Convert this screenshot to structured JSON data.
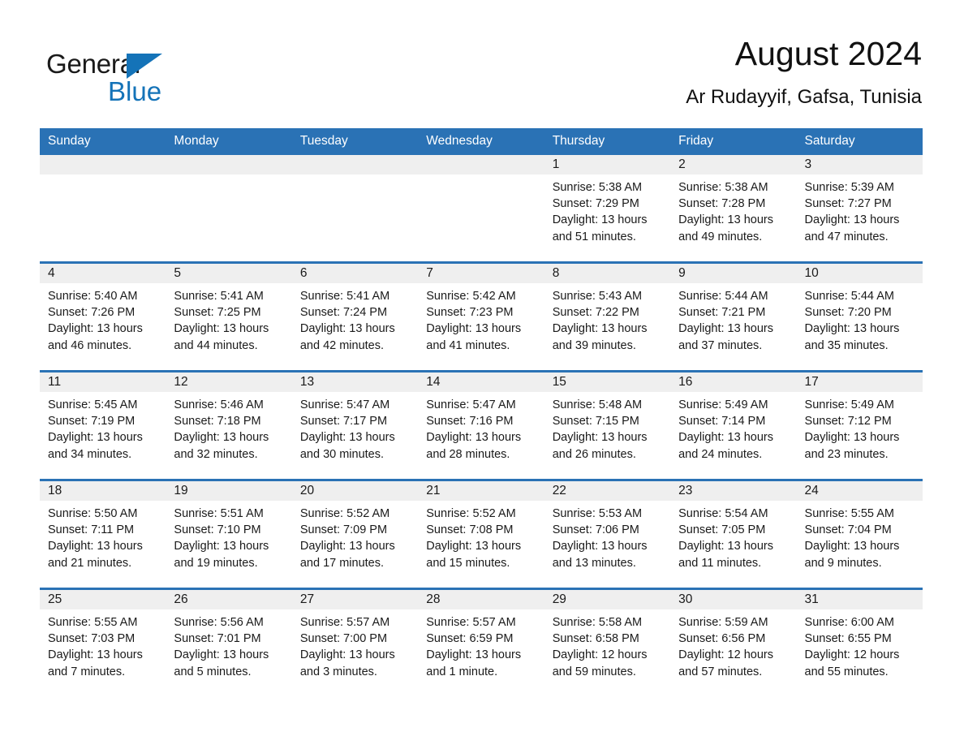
{
  "brand": {
    "name_part1": "General",
    "name_part2": "Blue",
    "triangle_color": "#1473b8"
  },
  "header": {
    "title": "August 2024",
    "subtitle": "Ar Rudayyif, Gafsa, Tunisia"
  },
  "colors": {
    "header_blue": "#2a72b5",
    "row_divider_blue": "#2a72b5",
    "daynum_band_gray": "#efefef",
    "text": "#1a1a1a",
    "background": "#ffffff"
  },
  "weekday_headers": [
    "Sunday",
    "Monday",
    "Tuesday",
    "Wednesday",
    "Thursday",
    "Friday",
    "Saturday"
  ],
  "weeks": [
    [
      {
        "empty": true
      },
      {
        "empty": true
      },
      {
        "empty": true
      },
      {
        "empty": true
      },
      {
        "empty": false,
        "day": "1",
        "sunrise": "Sunrise: 5:38 AM",
        "sunset": "Sunset: 7:29 PM",
        "daylight_l1": "Daylight: 13 hours",
        "daylight_l2": "and 51 minutes."
      },
      {
        "empty": false,
        "day": "2",
        "sunrise": "Sunrise: 5:38 AM",
        "sunset": "Sunset: 7:28 PM",
        "daylight_l1": "Daylight: 13 hours",
        "daylight_l2": "and 49 minutes."
      },
      {
        "empty": false,
        "day": "3",
        "sunrise": "Sunrise: 5:39 AM",
        "sunset": "Sunset: 7:27 PM",
        "daylight_l1": "Daylight: 13 hours",
        "daylight_l2": "and 47 minutes."
      }
    ],
    [
      {
        "empty": false,
        "day": "4",
        "sunrise": "Sunrise: 5:40 AM",
        "sunset": "Sunset: 7:26 PM",
        "daylight_l1": "Daylight: 13 hours",
        "daylight_l2": "and 46 minutes."
      },
      {
        "empty": false,
        "day": "5",
        "sunrise": "Sunrise: 5:41 AM",
        "sunset": "Sunset: 7:25 PM",
        "daylight_l1": "Daylight: 13 hours",
        "daylight_l2": "and 44 minutes."
      },
      {
        "empty": false,
        "day": "6",
        "sunrise": "Sunrise: 5:41 AM",
        "sunset": "Sunset: 7:24 PM",
        "daylight_l1": "Daylight: 13 hours",
        "daylight_l2": "and 42 minutes."
      },
      {
        "empty": false,
        "day": "7",
        "sunrise": "Sunrise: 5:42 AM",
        "sunset": "Sunset: 7:23 PM",
        "daylight_l1": "Daylight: 13 hours",
        "daylight_l2": "and 41 minutes."
      },
      {
        "empty": false,
        "day": "8",
        "sunrise": "Sunrise: 5:43 AM",
        "sunset": "Sunset: 7:22 PM",
        "daylight_l1": "Daylight: 13 hours",
        "daylight_l2": "and 39 minutes."
      },
      {
        "empty": false,
        "day": "9",
        "sunrise": "Sunrise: 5:44 AM",
        "sunset": "Sunset: 7:21 PM",
        "daylight_l1": "Daylight: 13 hours",
        "daylight_l2": "and 37 minutes."
      },
      {
        "empty": false,
        "day": "10",
        "sunrise": "Sunrise: 5:44 AM",
        "sunset": "Sunset: 7:20 PM",
        "daylight_l1": "Daylight: 13 hours",
        "daylight_l2": "and 35 minutes."
      }
    ],
    [
      {
        "empty": false,
        "day": "11",
        "sunrise": "Sunrise: 5:45 AM",
        "sunset": "Sunset: 7:19 PM",
        "daylight_l1": "Daylight: 13 hours",
        "daylight_l2": "and 34 minutes."
      },
      {
        "empty": false,
        "day": "12",
        "sunrise": "Sunrise: 5:46 AM",
        "sunset": "Sunset: 7:18 PM",
        "daylight_l1": "Daylight: 13 hours",
        "daylight_l2": "and 32 minutes."
      },
      {
        "empty": false,
        "day": "13",
        "sunrise": "Sunrise: 5:47 AM",
        "sunset": "Sunset: 7:17 PM",
        "daylight_l1": "Daylight: 13 hours",
        "daylight_l2": "and 30 minutes."
      },
      {
        "empty": false,
        "day": "14",
        "sunrise": "Sunrise: 5:47 AM",
        "sunset": "Sunset: 7:16 PM",
        "daylight_l1": "Daylight: 13 hours",
        "daylight_l2": "and 28 minutes."
      },
      {
        "empty": false,
        "day": "15",
        "sunrise": "Sunrise: 5:48 AM",
        "sunset": "Sunset: 7:15 PM",
        "daylight_l1": "Daylight: 13 hours",
        "daylight_l2": "and 26 minutes."
      },
      {
        "empty": false,
        "day": "16",
        "sunrise": "Sunrise: 5:49 AM",
        "sunset": "Sunset: 7:14 PM",
        "daylight_l1": "Daylight: 13 hours",
        "daylight_l2": "and 24 minutes."
      },
      {
        "empty": false,
        "day": "17",
        "sunrise": "Sunrise: 5:49 AM",
        "sunset": "Sunset: 7:12 PM",
        "daylight_l1": "Daylight: 13 hours",
        "daylight_l2": "and 23 minutes."
      }
    ],
    [
      {
        "empty": false,
        "day": "18",
        "sunrise": "Sunrise: 5:50 AM",
        "sunset": "Sunset: 7:11 PM",
        "daylight_l1": "Daylight: 13 hours",
        "daylight_l2": "and 21 minutes."
      },
      {
        "empty": false,
        "day": "19",
        "sunrise": "Sunrise: 5:51 AM",
        "sunset": "Sunset: 7:10 PM",
        "daylight_l1": "Daylight: 13 hours",
        "daylight_l2": "and 19 minutes."
      },
      {
        "empty": false,
        "day": "20",
        "sunrise": "Sunrise: 5:52 AM",
        "sunset": "Sunset: 7:09 PM",
        "daylight_l1": "Daylight: 13 hours",
        "daylight_l2": "and 17 minutes."
      },
      {
        "empty": false,
        "day": "21",
        "sunrise": "Sunrise: 5:52 AM",
        "sunset": "Sunset: 7:08 PM",
        "daylight_l1": "Daylight: 13 hours",
        "daylight_l2": "and 15 minutes."
      },
      {
        "empty": false,
        "day": "22",
        "sunrise": "Sunrise: 5:53 AM",
        "sunset": "Sunset: 7:06 PM",
        "daylight_l1": "Daylight: 13 hours",
        "daylight_l2": "and 13 minutes."
      },
      {
        "empty": false,
        "day": "23",
        "sunrise": "Sunrise: 5:54 AM",
        "sunset": "Sunset: 7:05 PM",
        "daylight_l1": "Daylight: 13 hours",
        "daylight_l2": "and 11 minutes."
      },
      {
        "empty": false,
        "day": "24",
        "sunrise": "Sunrise: 5:55 AM",
        "sunset": "Sunset: 7:04 PM",
        "daylight_l1": "Daylight: 13 hours",
        "daylight_l2": "and 9 minutes."
      }
    ],
    [
      {
        "empty": false,
        "day": "25",
        "sunrise": "Sunrise: 5:55 AM",
        "sunset": "Sunset: 7:03 PM",
        "daylight_l1": "Daylight: 13 hours",
        "daylight_l2": "and 7 minutes."
      },
      {
        "empty": false,
        "day": "26",
        "sunrise": "Sunrise: 5:56 AM",
        "sunset": "Sunset: 7:01 PM",
        "daylight_l1": "Daylight: 13 hours",
        "daylight_l2": "and 5 minutes."
      },
      {
        "empty": false,
        "day": "27",
        "sunrise": "Sunrise: 5:57 AM",
        "sunset": "Sunset: 7:00 PM",
        "daylight_l1": "Daylight: 13 hours",
        "daylight_l2": "and 3 minutes."
      },
      {
        "empty": false,
        "day": "28",
        "sunrise": "Sunrise: 5:57 AM",
        "sunset": "Sunset: 6:59 PM",
        "daylight_l1": "Daylight: 13 hours",
        "daylight_l2": "and 1 minute."
      },
      {
        "empty": false,
        "day": "29",
        "sunrise": "Sunrise: 5:58 AM",
        "sunset": "Sunset: 6:58 PM",
        "daylight_l1": "Daylight: 12 hours",
        "daylight_l2": "and 59 minutes."
      },
      {
        "empty": false,
        "day": "30",
        "sunrise": "Sunrise: 5:59 AM",
        "sunset": "Sunset: 6:56 PM",
        "daylight_l1": "Daylight: 12 hours",
        "daylight_l2": "and 57 minutes."
      },
      {
        "empty": false,
        "day": "31",
        "sunrise": "Sunrise: 6:00 AM",
        "sunset": "Sunset: 6:55 PM",
        "daylight_l1": "Daylight: 12 hours",
        "daylight_l2": "and 55 minutes."
      }
    ]
  ]
}
